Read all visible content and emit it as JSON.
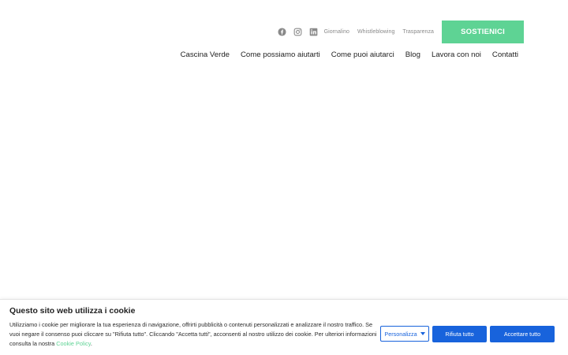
{
  "header": {
    "social": [
      {
        "name": "facebook-icon"
      },
      {
        "name": "instagram-icon"
      },
      {
        "name": "linkedin-icon"
      }
    ],
    "top_links": [
      "Giornalino",
      "Whistleblowing",
      "Trasparenza"
    ],
    "donate_label": "SOSTIENICI"
  },
  "nav": {
    "items": [
      "Cascina Verde",
      "Come possiamo aiutarti",
      "Come puoi aiutarci",
      "Blog",
      "Lavora con noi",
      "Contatti"
    ]
  },
  "cookie": {
    "title": "Questo sito web utilizza i cookie",
    "text": "Utilizziamo i cookie per migliorare la tua esperienza di navigazione, offrirti pubblicità o contenuti personalizzati e analizzare il nostro traffico. Se vuoi negare il consenso puoi cliccare su \"Rifiuta tutto\". Cliccando \"Accetta tutti\", acconsenti al nostro utilizzo dei cookie. Per ulteriori informazioni consulta la nostra",
    "policy_link": "Cookie Policy",
    "text_end": ".",
    "customize_label": "Personalizza",
    "reject_label": "Rifiuta tutto",
    "accept_label": "Accettare tutto"
  },
  "colors": {
    "accent_green": "#5ed394",
    "cookie_blue": "#1863dc",
    "icon_gray": "#8a8a8a"
  }
}
